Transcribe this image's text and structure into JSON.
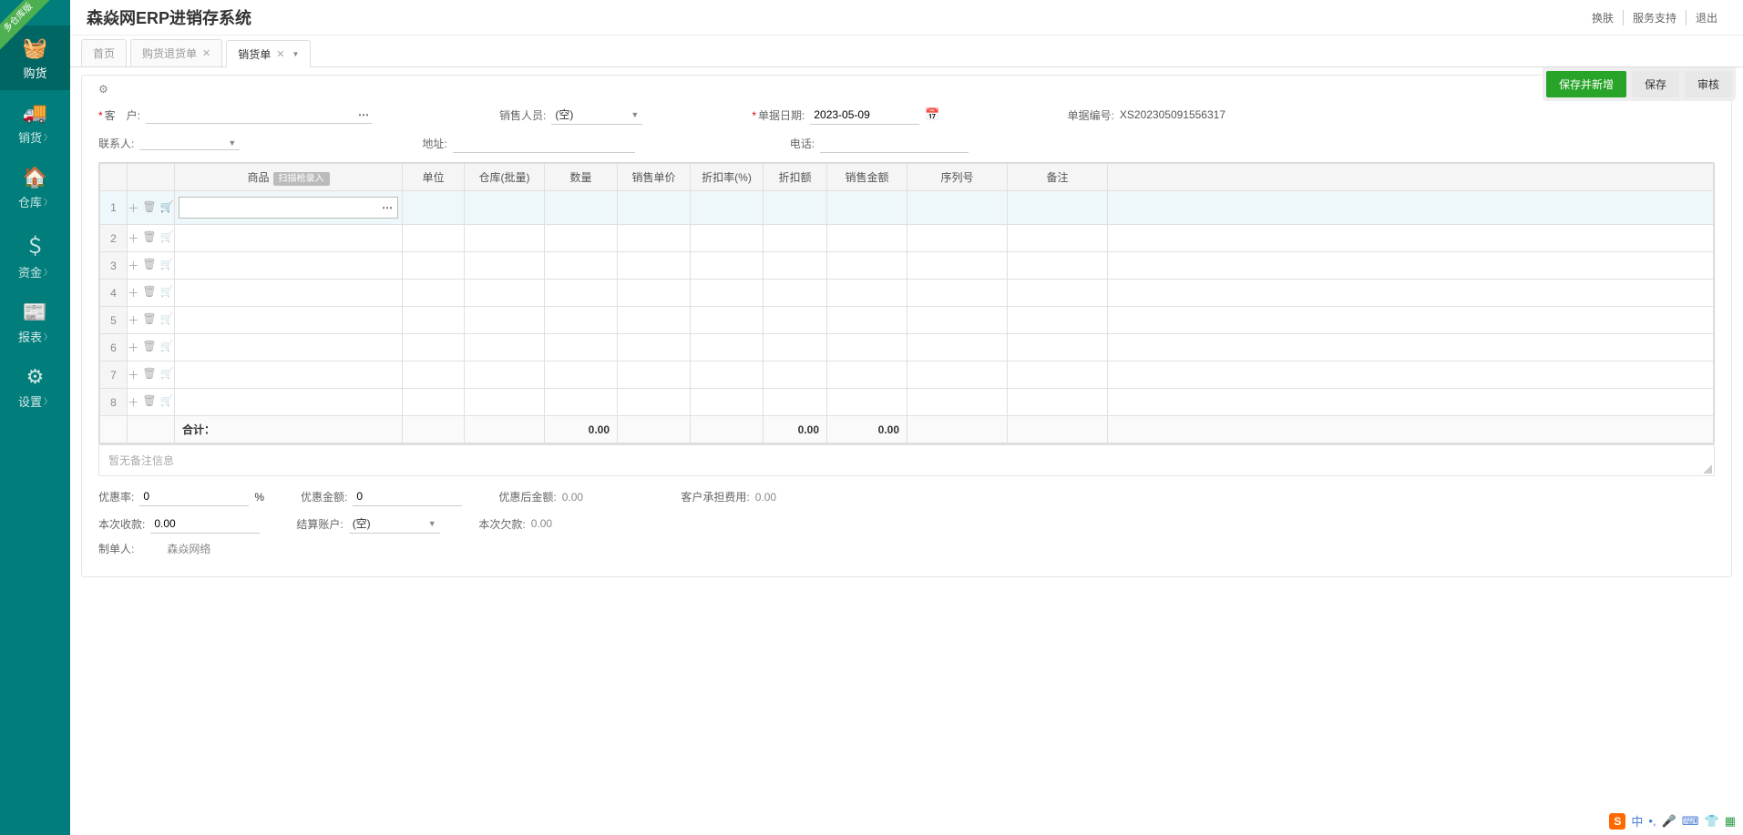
{
  "cornerBadge": "多仓库版",
  "header": {
    "title": "森焱网ERP进销存系统",
    "links": [
      "换肤",
      "服务支持",
      "退出"
    ]
  },
  "sidebar": [
    {
      "label": "购货",
      "icon": "🧺",
      "hasChevron": false,
      "active": true
    },
    {
      "label": "销货",
      "icon": "🚚",
      "hasChevron": true
    },
    {
      "label": "仓库",
      "icon": "🏠",
      "hasChevron": true
    },
    {
      "label": "资金",
      "icon": "＄",
      "hasChevron": true
    },
    {
      "label": "报表",
      "icon": "📰",
      "hasChevron": true
    },
    {
      "label": "设置",
      "icon": "⚙",
      "hasChevron": true
    }
  ],
  "tabs": [
    {
      "label": "首页",
      "closable": false,
      "active": false,
      "menu": false
    },
    {
      "label": "购货退货单",
      "closable": true,
      "active": false,
      "menu": false
    },
    {
      "label": "销货单",
      "closable": true,
      "active": true,
      "menu": true
    }
  ],
  "actions": {
    "saveNew": "保存并新增",
    "save": "保存",
    "audit": "审核"
  },
  "form": {
    "customerLabel": "客　户:",
    "salesPersonLabel": "销售人员:",
    "salesPersonValue": "(空)",
    "billDateLabel": "单据日期:",
    "billDateValue": "2023-05-09",
    "billNoLabel": "单据编号:",
    "billNoValue": "XS202305091556317",
    "contactLabel": "联系人:",
    "addressLabel": "地址:",
    "phoneLabel": "电话:"
  },
  "table": {
    "headers": {
      "product": "商品",
      "scan": "扫描枪录入",
      "unit": "单位",
      "warehouse": "仓库(批量)",
      "qty": "数量",
      "price": "销售单价",
      "discountRate": "折扣率(%)",
      "discountAmt": "折扣额",
      "amount": "销售金额",
      "serial": "序列号",
      "remark": "备注"
    },
    "rowCount": 8,
    "sumLabel": "合计：",
    "sumQty": "0.00",
    "sumDiscount": "0.00",
    "sumAmount": "0.00"
  },
  "notesPlaceholder": "暂无备注信息",
  "bottom": {
    "discountRateLabel": "优惠率:",
    "discountRateValue": "0",
    "percent": "%",
    "discountAmtLabel": "优惠金额:",
    "discountAmtValue": "0",
    "afterDiscountLabel": "优惠后金额:",
    "afterDiscountValue": "0.00",
    "customerFeeLabel": "客户承担费用:",
    "customerFeeValue": "0.00",
    "thisReceiveLabel": "本次收款:",
    "thisReceiveValue": "0.00",
    "settleAccountLabel": "结算账户:",
    "settleAccountValue": "(空)",
    "thisOweLabel": "本次欠款:",
    "thisOweValue": "0.00",
    "creatorLabel": "制单人:",
    "creatorValue": "森焱网络"
  },
  "ime": {
    "logo": "S",
    "lang": "中"
  }
}
